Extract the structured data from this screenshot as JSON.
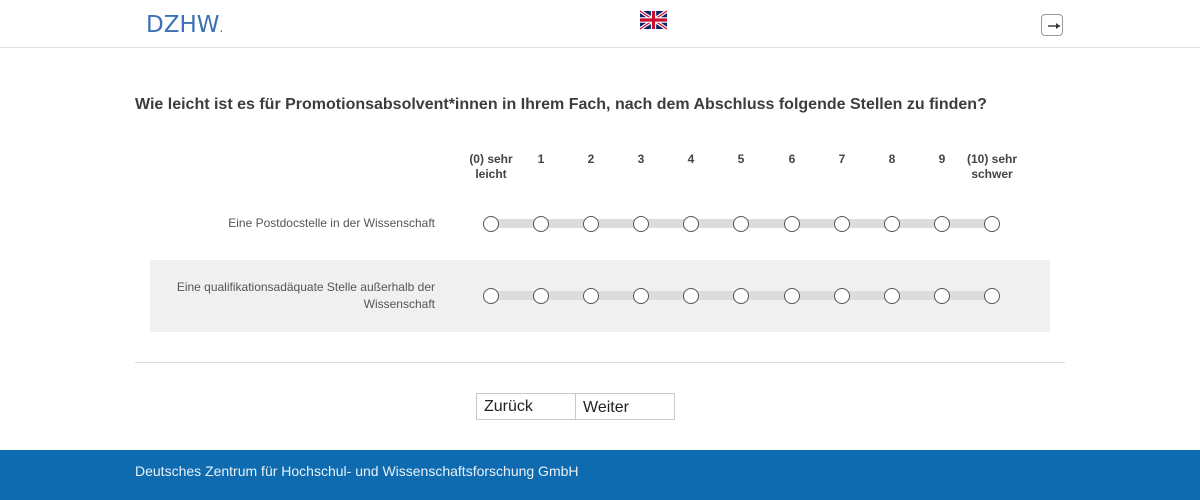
{
  "header": {
    "logo_text": "DZHW",
    "logo_dot": ".",
    "language_flag": "uk-flag-icon",
    "logout_icon": "logout-icon"
  },
  "question": {
    "text": "Wie leicht ist es für Promotionsabsolvent*innen in Ihrem Fach, nach dem Abschluss folgende Stellen zu finden?",
    "scale_labels": [
      "(0) sehr leicht",
      "1",
      "2",
      "3",
      "4",
      "5",
      "6",
      "7",
      "8",
      "9",
      "(10) sehr schwer"
    ],
    "items": [
      {
        "label": "Eine Postdocstelle in der Wissenschaft",
        "selected": null
      },
      {
        "label": "Eine qualifikationsadäquate Stelle außerhalb der Wissenschaft",
        "selected": null
      }
    ]
  },
  "navigation": {
    "back_label": "Zurück",
    "next_label": "Weiter"
  },
  "footer": {
    "text": "Deutsches Zentrum für Hochschul- und Wissenschaftsforschung GmbH"
  },
  "colors": {
    "brand_blue": "#3a72b5",
    "footer_blue": "#0f6bb0",
    "row_alt_bg": "#f0f0f0",
    "track": "#dcdcdc"
  }
}
